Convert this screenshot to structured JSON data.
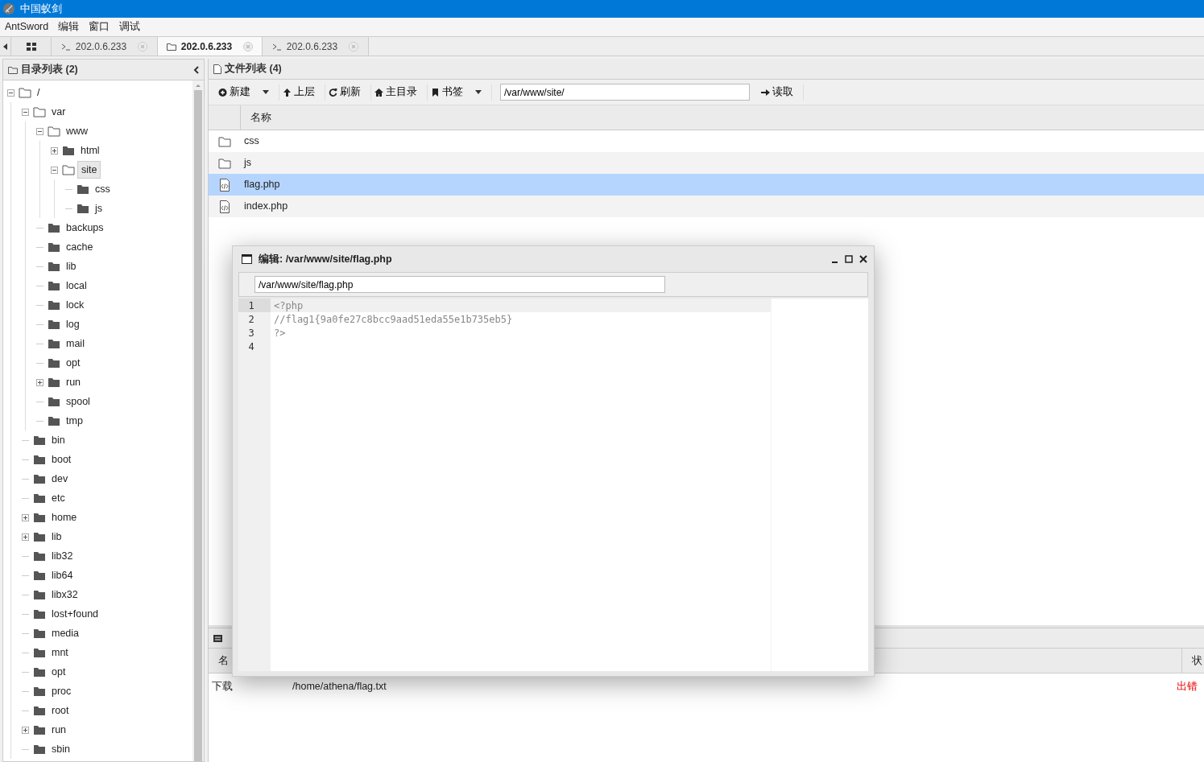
{
  "window": {
    "title": "中国蚁剑"
  },
  "menu": [
    "AntSword",
    "编辑",
    "窗口",
    "调试"
  ],
  "tabs": [
    {
      "kind": "grid",
      "selected": false
    },
    {
      "kind": "terminal",
      "label": "202.0.6.233",
      "selected": false
    },
    {
      "kind": "folder",
      "label": "202.0.6.233",
      "selected": true
    },
    {
      "kind": "terminal",
      "label": "202.0.6.233",
      "selected": false
    }
  ],
  "directory_panel": {
    "title": "目录列表 (2)",
    "tree": [
      {
        "name": "/",
        "expanded": true,
        "selected": false,
        "children": [
          {
            "name": "var",
            "expanded": true,
            "selected": false,
            "children": [
              {
                "name": "www",
                "expanded": true,
                "selected": false,
                "children": [
                  {
                    "name": "html",
                    "expanded": false,
                    "selected": false
                  },
                  {
                    "name": "site",
                    "expanded": true,
                    "selected": true,
                    "children": [
                      {
                        "name": "css",
                        "selected": false
                      },
                      {
                        "name": "js",
                        "selected": false
                      }
                    ]
                  }
                ]
              },
              {
                "name": "backups",
                "selected": false
              },
              {
                "name": "cache",
                "selected": false
              },
              {
                "name": "lib",
                "selected": false
              },
              {
                "name": "local",
                "selected": false
              },
              {
                "name": "lock",
                "selected": false
              },
              {
                "name": "log",
                "selected": false
              },
              {
                "name": "mail",
                "selected": false
              },
              {
                "name": "opt",
                "selected": false
              },
              {
                "name": "run",
                "expanded": false,
                "selected": false
              },
              {
                "name": "spool",
                "selected": false
              },
              {
                "name": "tmp",
                "selected": false
              }
            ]
          },
          {
            "name": "bin",
            "selected": false
          },
          {
            "name": "boot",
            "selected": false
          },
          {
            "name": "dev",
            "selected": false
          },
          {
            "name": "etc",
            "selected": false
          },
          {
            "name": "home",
            "expanded": false,
            "selected": false
          },
          {
            "name": "lib",
            "expanded": false,
            "selected": false
          },
          {
            "name": "lib32",
            "selected": false
          },
          {
            "name": "lib64",
            "selected": false
          },
          {
            "name": "libx32",
            "selected": false
          },
          {
            "name": "lost+found",
            "selected": false
          },
          {
            "name": "media",
            "selected": false
          },
          {
            "name": "mnt",
            "selected": false
          },
          {
            "name": "opt",
            "selected": false
          },
          {
            "name": "proc",
            "selected": false
          },
          {
            "name": "root",
            "selected": false
          },
          {
            "name": "run",
            "expanded": false,
            "selected": false
          },
          {
            "name": "sbin",
            "selected": false
          }
        ]
      }
    ]
  },
  "file_panel": {
    "title": "文件列表 (4)",
    "toolbar": [
      {
        "kind": "new",
        "label": "新建",
        "dropdown": true
      },
      {
        "kind": "up",
        "label": "上层",
        "dropdown": false
      },
      {
        "kind": "refresh",
        "label": "刷新",
        "dropdown": false
      },
      {
        "kind": "home",
        "label": "主目录",
        "dropdown": false
      },
      {
        "kind": "bookmark",
        "label": "书签",
        "dropdown": true
      }
    ],
    "path": "/var/www/site/",
    "read_button": "读取",
    "columns": [
      "名称"
    ],
    "rows": [
      {
        "kind": "folder",
        "name": "css",
        "selected": false
      },
      {
        "kind": "folder",
        "name": "js",
        "selected": false
      },
      {
        "kind": "file",
        "name": "flag.php",
        "selected": true
      },
      {
        "kind": "file",
        "name": "index.php",
        "selected": false
      }
    ]
  },
  "task_panel": {
    "columns": [
      "名",
      "状"
    ],
    "rows": [
      {
        "type": "下载",
        "path": "/home/athena/flag.txt",
        "status": "出错"
      }
    ]
  },
  "editor": {
    "title": "编辑: /var/www/site/flag.php",
    "path": "/var/www/site/flag.php",
    "lines": [
      {
        "number": "1",
        "code": "<?php",
        "selected": true
      },
      {
        "number": "2",
        "code": "//flag1{9a0fe27c8bcc9aad51eda55e1b735eb5}",
        "selected": false
      },
      {
        "number": "3",
        "code": "?>",
        "selected": false
      },
      {
        "number": "4",
        "selected": false
      }
    ]
  }
}
